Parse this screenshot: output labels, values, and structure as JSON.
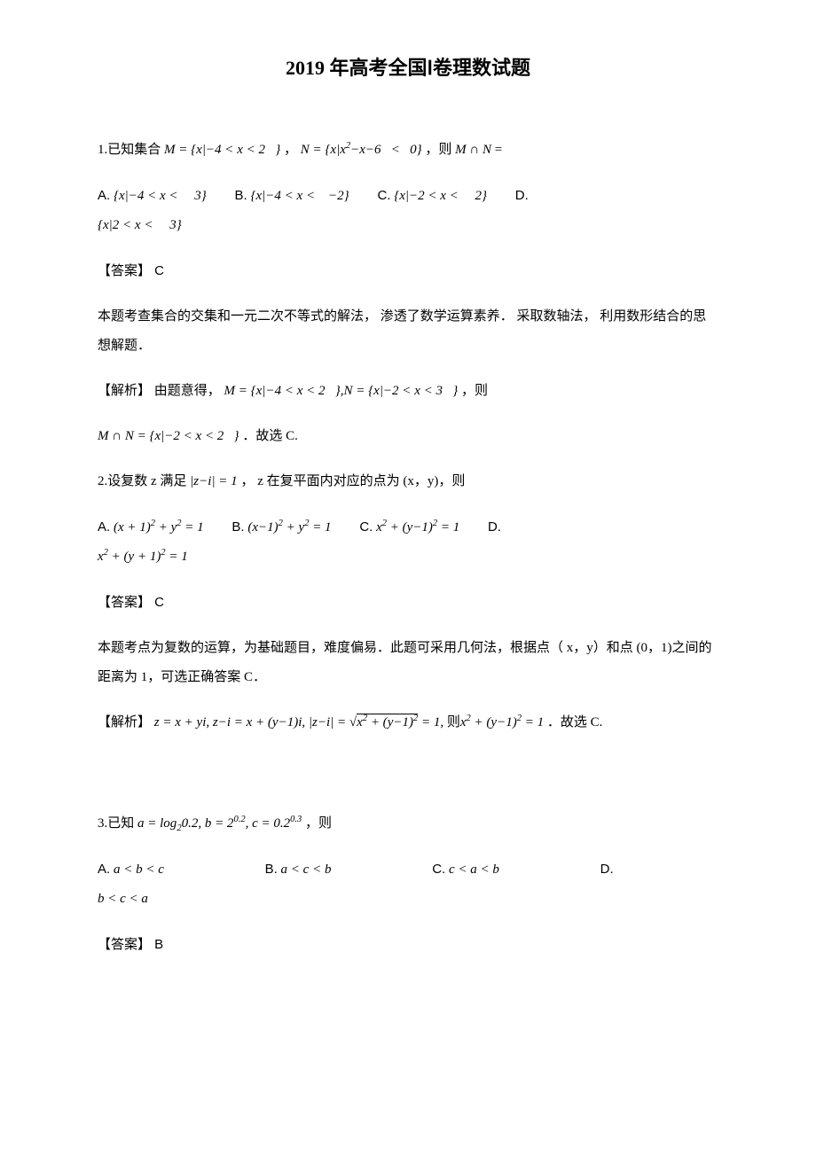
{
  "title": "2019  年高考全国Ⅰ卷理数试题",
  "q1": {
    "stem_prefix": "1.已知集合 ",
    "m_def": "M = {x|−4 < x < 2   }",
    "sep1": "，",
    "n_def": "N = {x|x²−x−6   <   0}",
    "sep2": "，则 ",
    "mn": "M ∩ N",
    "eq": "=",
    "optA_label": "A.",
    "optA": "{x|−4 < x <     3}",
    "optB_label": "B.",
    "optB": "{x|−4 < x <    −2}",
    "optC_label": "C.",
    "optC": "{x|−2 < x <     2}",
    "optD_label": "D.",
    "optD": "{x|2 < x <     3}",
    "answer_label": "【答案】",
    "answer": " C",
    "expl1": "本题考查集合的交集和一元二次不等式的解法，    渗透了数学运算素养．   采取数轴法，  利用数形结合的思想解题．",
    "analysis_label": "【解析】",
    "analysis1": "由题意得，    ",
    "analysis_m": "M = {x|−4 < x < 2   }",
    "analysis_comma": ",",
    "analysis_n": "N = {x|−2 < x < 3   }",
    "analysis_tail": "，则",
    "analysis2_a": "M ∩ N = {x|−2 < x < 2   }",
    "analysis2_b": "．故选  C."
  },
  "q2": {
    "stem_prefix": "2.设复数  z 满足 ",
    "cond": "|z−i| = 1",
    "stem_mid": "， z 在复平面内对应的点为   (x，y)，则",
    "optA_label": "A.",
    "optA": "(x + 1)² + y² = 1",
    "optB_label": "B.",
    "optB": "(x−1)² + y² = 1",
    "optC_label": "C.",
    "optC": "x² + (y−1)² = 1",
    "optD_label": "D.",
    "optD": "x² + (y + 1)² = 1",
    "answer_label": "【答案】",
    "answer": " C",
    "expl1": "本题考点为复数的运算，为基础题目，难度偏易．此题可采用几何法，根据点（          x，y）和点 (0，1)之间的距离为   1，可选正确答案   C．",
    "analysis_label": "【解析】",
    "analysis_a": "z = x + yi, z−i = x + (y−1)i, |z−i| = ",
    "analysis_sqrt": "x² + (y−1)²",
    "analysis_b": " = 1, 则",
    "analysis_c": "x² + (y−1)² = 1",
    "analysis_tail": "．故选  C."
  },
  "q3": {
    "stem_prefix": "3.已知 ",
    "defs": "a = log₂0.2, b = 2⁰·², c = 0.2⁰·³",
    "stem_tail": "，则",
    "optA_label": "A.",
    "optA": "a < b < c",
    "optB_label": "B.",
    "optB": "a < c < b",
    "optC_label": "C.",
    "optC": "c < a < b",
    "optD_label": "D.",
    "optD": "b < c < a",
    "answer_label": "【答案】",
    "answer": " B"
  }
}
